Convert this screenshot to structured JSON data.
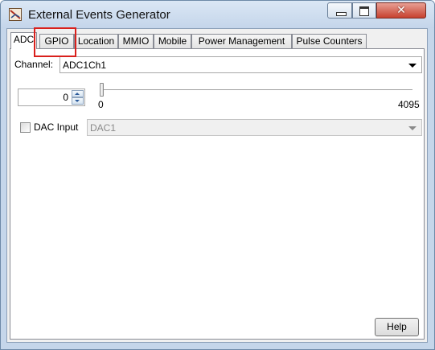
{
  "window": {
    "title": "External Events Generator",
    "app_icon": "generator-app-icon",
    "controls": {
      "minimize": "minimize-icon",
      "maximize": "maximize-icon",
      "close_glyph": "✕"
    }
  },
  "tabs": [
    {
      "label": "ADC",
      "active": true
    },
    {
      "label": "GPIO",
      "highlighted": true
    },
    {
      "label": "Location"
    },
    {
      "label": "MMIO"
    },
    {
      "label": "Mobile"
    },
    {
      "label": "Power Management"
    },
    {
      "label": "Pulse Counters"
    }
  ],
  "adc": {
    "channel_label": "Channel:",
    "channel_value": "ADC1Ch1",
    "spinner_value": "0",
    "slider": {
      "min_label": "0",
      "max_label": "4095",
      "value": 0,
      "min": 0,
      "max": 4095
    },
    "dac_checkbox_label": "DAC Input",
    "dac_checked": false,
    "dac_value": "DAC1"
  },
  "footer": {
    "help_label": "Help"
  },
  "colors": {
    "highlight": "#d9201c",
    "close_button": "#c7412f",
    "titlebar": "#c4d5ea"
  }
}
